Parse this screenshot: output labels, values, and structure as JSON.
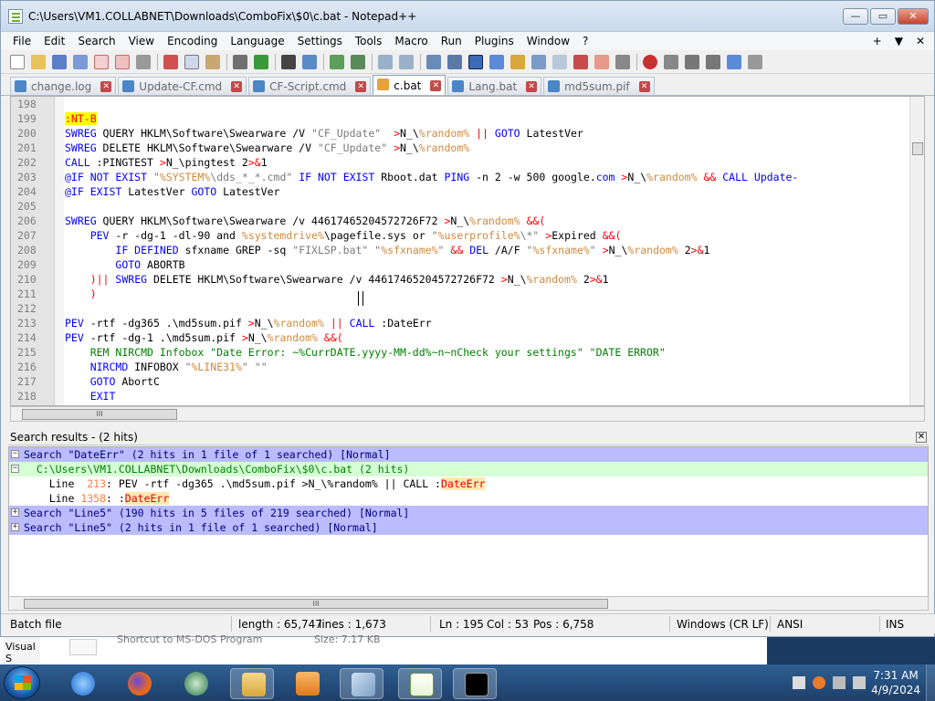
{
  "window": {
    "title": "C:\\Users\\VM1.COLLABNET\\Downloads\\ComboFix\\$0\\c.bat - Notepad++",
    "minimize": "—",
    "maximize": "▭",
    "close": "✕"
  },
  "menu": {
    "items": [
      "File",
      "Edit",
      "Search",
      "View",
      "Encoding",
      "Language",
      "Settings",
      "Tools",
      "Macro",
      "Run",
      "Plugins",
      "Window",
      "?"
    ],
    "right": [
      "+",
      "▼",
      "✕"
    ]
  },
  "tabs": [
    {
      "label": "change.log",
      "active": false
    },
    {
      "label": "Update-CF.cmd",
      "active": false
    },
    {
      "label": "CF-Script.cmd",
      "active": false
    },
    {
      "label": "c.bat",
      "active": true
    },
    {
      "label": "Lang.bat",
      "active": false
    },
    {
      "label": "md5sum.pif",
      "active": false
    }
  ],
  "code": {
    "lines": [
      {
        "n": "198",
        "html": ""
      },
      {
        "n": "199",
        "html": "<span class='lbl'>:NT-B</span>"
      },
      {
        "n": "200",
        "html": "<span class='kw'>SWREG</span> QUERY HKLM\\Software\\Swearware /V <span class='str'>\"CF_Update\"</span>  <span class='op'>&gt;</span>N_\\<span class='var'>%random%</span> <span class='op'>||</span> <span class='kw'>GOTO</span> LatestVer"
      },
      {
        "n": "201",
        "html": "<span class='kw'>SWREG</span> DELETE HKLM\\Software\\Swearware /V <span class='str'>\"CF_Update\"</span> <span class='op'>&gt;</span>N_\\<span class='var'>%random%</span>"
      },
      {
        "n": "202",
        "html": "<span class='kw'>CALL</span> :PINGTEST <span class='op'>&gt;</span>N_\\pingtest 2<span class='op'>&gt;&amp;</span>1"
      },
      {
        "n": "203",
        "html": "<span class='kw'>@IF NOT EXIST</span> <span class='str'>\"</span><span class='var'>%SYSTEM%</span><span class='str'>\\dds_*_*.cmd\"</span> <span class='kw'>IF NOT EXIST</span> Rboot.dat <span class='kw'>PING</span> -n 2 -w 500 google.<span class='kw'>com</span> <span class='op'>&gt;</span>N_\\<span class='var'>%random%</span> <span class='op'>&amp;&amp;</span> <span class='kw'>CALL</span> <span class='url'>Update-</span>"
      },
      {
        "n": "204",
        "html": "<span class='kw'>@IF EXIST</span> LatestVer <span class='kw'>GOTO</span> LatestVer"
      },
      {
        "n": "205",
        "html": ""
      },
      {
        "n": "206",
        "html": "<span class='kw'>SWREG</span> QUERY HKLM\\Software\\Swearware /v 44617465204572726F72 <span class='op'>&gt;</span>N_\\<span class='var'>%random%</span> <span class='op'>&amp;&amp;(</span>"
      },
      {
        "n": "207",
        "html": "    <span class='kw'>PEV</span> -r -dg-1 -dl-90 and <span class='var'>%systemdrive%</span>\\pagefile.sys or <span class='str'>\"</span><span class='var'>%userprofile%</span><span class='str'>\\*\"</span> <span class='op'>&gt;</span>Expired <span class='op'>&amp;&amp;(</span>"
      },
      {
        "n": "208",
        "html": "        <span class='kw'>IF DEFINED</span> sfxname GREP -sq <span class='str'>\"FIXLSP.bat\"</span> <span class='str'>\"</span><span class='var'>%sfxname%</span><span class='str'>\"</span> <span class='op'>&amp;&amp;</span> <span class='kw'>DEL</span> /A/F <span class='str'>\"</span><span class='var'>%sfxname%</span><span class='str'>\"</span> <span class='op'>&gt;</span>N_\\<span class='var'>%random%</span> 2<span class='op'>&gt;&amp;</span>1"
      },
      {
        "n": "209",
        "html": "        <span class='kw'>GOTO</span> ABORTB"
      },
      {
        "n": "210",
        "html": "    <span class='op'>)||</span> <span class='kw'>SWREG</span> DELETE HKLM\\Software\\Swearware /v 44617465204572726F72 <span class='op'>&gt;</span>N_\\<span class='var'>%random%</span> 2<span class='op'>&gt;&amp;</span>1"
      },
      {
        "n": "211",
        "html": "    <span class='op'>)</span>"
      },
      {
        "n": "212",
        "html": ""
      },
      {
        "n": "213",
        "html": "<span class='kw'>PEV</span> -rtf -dg365 .\\md5sum.pif <span class='op'>&gt;</span>N_\\<span class='var'>%random%</span> <span class='op'>||</span> <span class='kw'>CALL</span> :DateErr"
      },
      {
        "n": "214",
        "html": "<span class='kw'>PEV</span> -rtf -dg-1 .\\md5sum.pif <span class='op'>&gt;</span>N_\\<span class='var'>%random%</span> <span class='op'>&amp;&amp;(</span>"
      },
      {
        "n": "215",
        "html": "    <span class='cm'>REM NIRCMD Infobox \"Date Error: ~%CurrDATE.yyyy-MM-dd%~n~nCheck your settings\" \"DATE ERROR\"</span>"
      },
      {
        "n": "216",
        "html": "    <span class='kw'>NIRCMD</span> INFOBOX <span class='str'>\"</span><span class='var'>%LINE31%</span><span class='str'>\"</span> <span class='str'>\"\"</span>"
      },
      {
        "n": "217",
        "html": "    <span class='kw'>GOTO</span> AbortC"
      },
      {
        "n": "218",
        "html": "    <span class='kw'>EXIT</span>"
      }
    ]
  },
  "search_panel": {
    "title": "Search results - (2 hits)",
    "close": "✕",
    "results": [
      {
        "type": "search",
        "box": "−",
        "text": "Search \"DateErr\" (2 hits in 1 file of 1 searched) [Normal]"
      },
      {
        "type": "file",
        "box": "−",
        "text": "  C:\\Users\\VM1.COLLABNET\\Downloads\\ComboFix\\$0\\c.bat (2 hits)"
      },
      {
        "type": "hit",
        "pre": "    Line  ",
        "num": "213",
        "mid": ": PEV -rtf -dg365 .\\md5sum.pif >N_\\%random% || CALL :",
        "hl": "DateErr"
      },
      {
        "type": "hit",
        "pre": "    Line ",
        "num": "1358",
        "mid": ": :",
        "hl": "DateErr"
      },
      {
        "type": "search",
        "box": "+",
        "text": "Search \"Line5\" (190 hits in 5 files of 219 searched) [Normal]"
      },
      {
        "type": "search",
        "box": "+",
        "text": "Search \"Line5\" (2 hits in 1 file of 1 searched) [Normal]"
      }
    ]
  },
  "status": {
    "filetype": "Batch file",
    "length": "length : 65,747",
    "lines": "lines : 1,673",
    "ln": "Ln : 195",
    "col": "Col : 53",
    "pos": "Pos : 6,758",
    "eol": "Windows (CR LF)",
    "encoding": "ANSI",
    "mode": "INS"
  },
  "behind": {
    "left": "Visual S",
    "t1": "Shortcut to MS-DOS Program",
    "t2": "Size: 7.17 KB"
  },
  "taskbar": {
    "time": "7:31 AM",
    "date": "4/9/2024"
  },
  "scroll": {
    "grip": "III"
  }
}
